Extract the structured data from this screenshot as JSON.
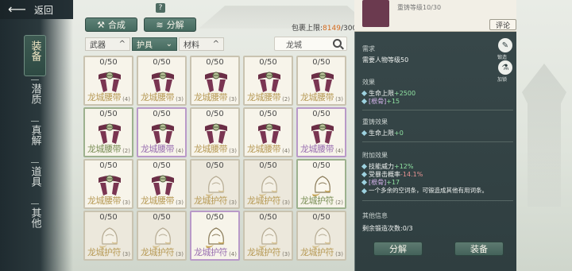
{
  "top": {
    "back_label": "返回",
    "hint_icon": "?",
    "compose_label": "合成",
    "decompose_label": "分解",
    "capacity_label": "包裹上限:",
    "capacity_current": "8149",
    "capacity_max": "/300"
  },
  "sidebar": {
    "active": "装备",
    "items": [
      "潜质",
      "真解",
      "道具",
      "其他"
    ]
  },
  "tabs": [
    {
      "label": "武器",
      "active": false
    },
    {
      "label": "护具",
      "active": true
    },
    {
      "label": "材料",
      "active": false
    }
  ],
  "search": {
    "value": "龙城"
  },
  "items": [
    {
      "count": "0/50",
      "name": "龙城腰带",
      "lvl": "(4)",
      "kind": "belt",
      "rarity": "gold"
    },
    {
      "count": "0/50",
      "name": "龙城腰带",
      "lvl": "(3)",
      "kind": "belt",
      "rarity": "gold"
    },
    {
      "count": "0/50",
      "name": "龙城腰带",
      "lvl": "(3)",
      "kind": "belt",
      "rarity": "gold"
    },
    {
      "count": "0/50",
      "name": "龙城腰带",
      "lvl": "(2)",
      "kind": "belt",
      "rarity": "gold"
    },
    {
      "count": "0/50",
      "name": "龙城腰带",
      "lvl": "(3)",
      "kind": "belt",
      "rarity": "gold"
    },
    {
      "count": "0/50",
      "name": "龙城腰带",
      "lvl": "(2)",
      "kind": "belt",
      "rarity": "green"
    },
    {
      "count": "0/50",
      "name": "龙城腰带",
      "lvl": "(4)",
      "kind": "belt",
      "rarity": "purple"
    },
    {
      "count": "0/50",
      "name": "龙城腰带",
      "lvl": "(3)",
      "kind": "belt",
      "rarity": "gold"
    },
    {
      "count": "0/50",
      "name": "龙城腰带",
      "lvl": "(4)",
      "kind": "belt",
      "rarity": "gold"
    },
    {
      "count": "0/50",
      "name": "龙城腰带",
      "lvl": "(4)",
      "kind": "belt",
      "rarity": "purple"
    },
    {
      "count": "0/50",
      "name": "龙城腰带",
      "lvl": "(3)",
      "kind": "belt",
      "rarity": "gold"
    },
    {
      "count": "0/50",
      "name": "龙城腰带",
      "lvl": "(3)",
      "kind": "belt",
      "rarity": "gold"
    },
    {
      "count": "0/50",
      "name": "龙城护符",
      "lvl": "(3)",
      "kind": "charm",
      "rarity": "gold"
    },
    {
      "count": "0/50",
      "name": "龙城护符",
      "lvl": "(3)",
      "kind": "charm",
      "rarity": "gold"
    },
    {
      "count": "0/50",
      "name": "龙城护符",
      "lvl": "(2)",
      "kind": "charm",
      "rarity": "green"
    },
    {
      "count": "0/50",
      "name": "龙城护符",
      "lvl": "(3)",
      "kind": "charm",
      "rarity": "gold"
    },
    {
      "count": "0/50",
      "name": "龙城护符",
      "lvl": "(3)",
      "kind": "charm",
      "rarity": "gold"
    },
    {
      "count": "0/50",
      "name": "龙城护符",
      "lvl": "(4)",
      "kind": "charm",
      "rarity": "purple"
    },
    {
      "count": "0/50",
      "name": "龙城护符",
      "lvl": "(3)",
      "kind": "charm",
      "rarity": "gold"
    },
    {
      "count": "0/50",
      "name": "龙城护符",
      "lvl": "(3)",
      "kind": "charm",
      "rarity": "gold"
    }
  ],
  "detail": {
    "header_text": "重铸等级10/30",
    "comment_label": "评论",
    "req_title": "需求",
    "req_text": "需要人物等级50",
    "tools": [
      {
        "icon": "✎",
        "label": "锻造"
      },
      {
        "icon": "⚗",
        "label": "加锁"
      }
    ],
    "effect_title": "效果",
    "effect_1": "生命上限",
    "effect_1_val": "+2500",
    "effect_2_tag": "[根骨]",
    "effect_2_val": "+15",
    "recast_title": "重铸效果",
    "recast_1": "生命上限",
    "recast_1_val": "+0",
    "extra_title": "附加效果",
    "extra_1": "技能威力",
    "extra_1_val": "+12%",
    "extra_2": "受暴击概率",
    "extra_2_val": "-14.1%",
    "extra_3_tag": "[根骨]",
    "extra_3_val": "+17",
    "extra_4": "一个多余的空词条，可锻造成其他有用词条。",
    "other_title": "其他信息",
    "other_text": "剩余锻造次数:0/3",
    "decompose_label": "分解",
    "equip_label": "装备"
  }
}
